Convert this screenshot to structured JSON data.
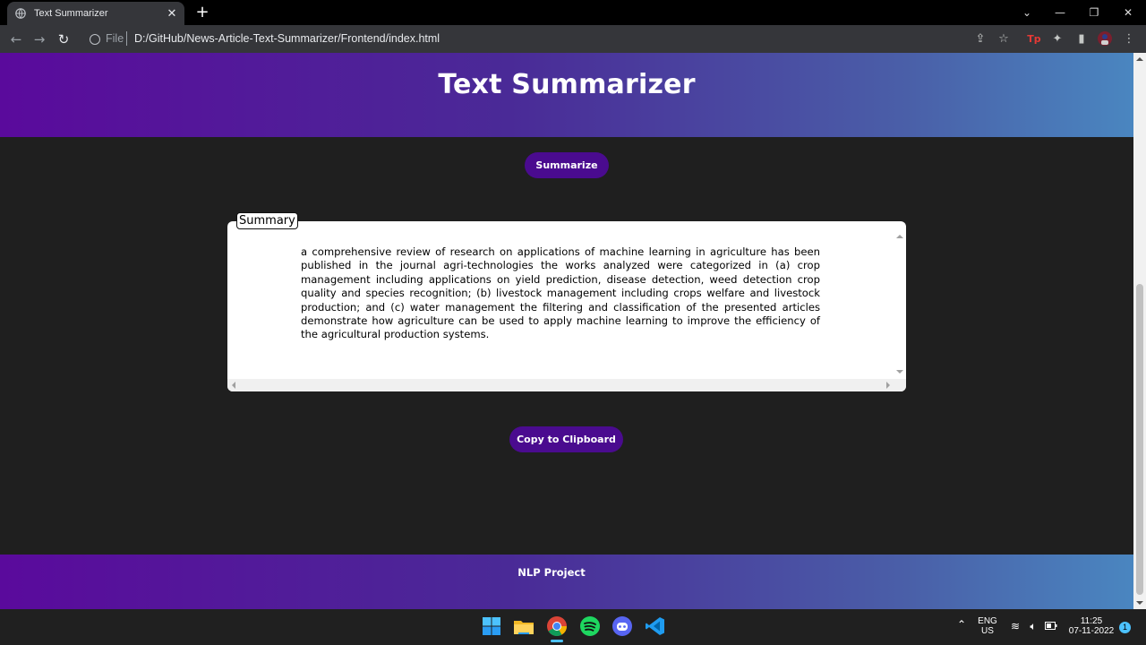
{
  "browser": {
    "tab_title": "Text Summarizer",
    "file_label": "File",
    "url": "D:/GitHub/News-Article-Text-Summarizer/Frontend/index.html"
  },
  "page": {
    "title": "Text Summarizer",
    "summarize_label": "Summarize",
    "summary_legend": "Summary",
    "summary_text": "a comprehensive review of research on applications of machine learning in agriculture has been published in the journal agri-technologies the works analyzed were categorized in (a) crop management including applications on yield prediction, disease detection, weed detection crop quality and species recognition; (b) livestock management including crops welfare and livestock production; and (c) water management the filtering and classification of the presented articles demonstrate how agriculture can be used to apply machine learning to improve the efficiency of the agricultural production systems.",
    "copy_label": "Copy to Clipboard",
    "footer_text": "NLP Project"
  },
  "colors": {
    "accent": "#4a0b8f",
    "gradient_start": "#5a0a9c",
    "gradient_end": "#4a86c0",
    "background": "#1f1f1f"
  },
  "taskbar": {
    "lang_top": "ENG",
    "lang_bottom": "US",
    "time": "11:25",
    "date": "07-11-2022",
    "notification_count": "1",
    "apps": [
      "windows-start-icon",
      "file-explorer-icon",
      "chrome-icon",
      "spotify-icon",
      "discord-icon",
      "vscode-icon"
    ]
  }
}
